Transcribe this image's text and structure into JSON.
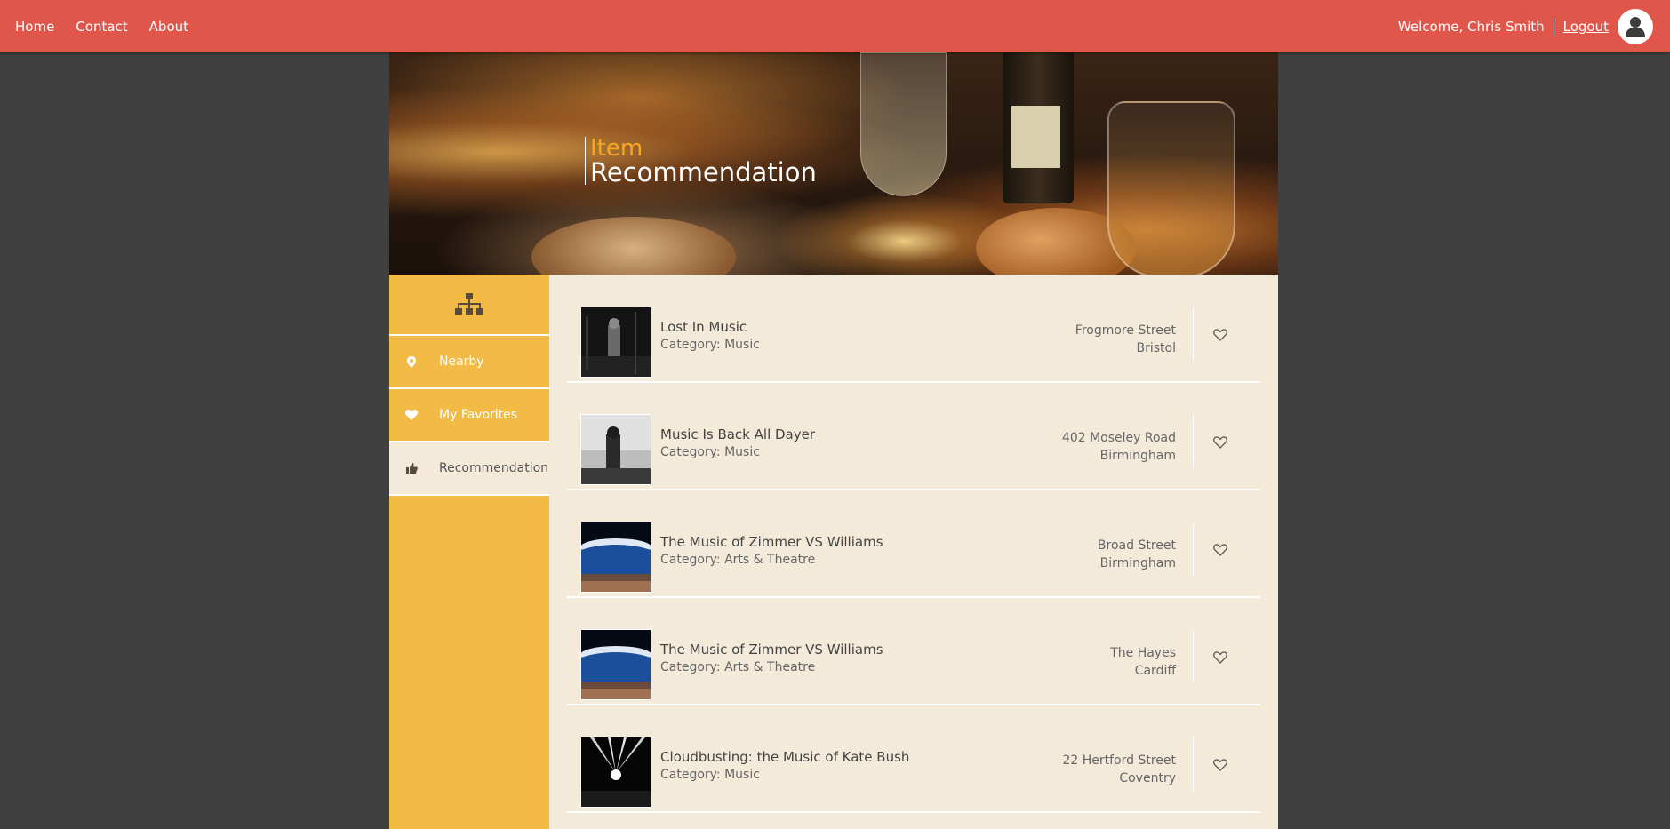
{
  "nav": {
    "home": "Home",
    "contact": "Contact",
    "about": "About"
  },
  "user": {
    "welcome": "Welcome, Chris Smith",
    "logout": "Logout",
    "avatar_icon": "user-icon"
  },
  "hero": {
    "title_line1": "Item",
    "title_line2": "Recommendation"
  },
  "sidebar": {
    "top_icon": "sitemap-icon",
    "items": [
      {
        "label": "Nearby",
        "icon": "map-pin-icon",
        "active": false
      },
      {
        "label": "My Favorites",
        "icon": "heart-icon",
        "active": false
      },
      {
        "label": "Recommendation",
        "icon": "thumbs-up-icon",
        "active": true
      }
    ]
  },
  "items": [
    {
      "name": "Lost In Music",
      "category": "Category: Music",
      "address1": "Frogmore Street",
      "address2": "Bristol"
    },
    {
      "name": "Music Is Back All Dayer",
      "category": "Category: Music",
      "address1": "402 Moseley Road",
      "address2": "Birmingham"
    },
    {
      "name": "The Music of Zimmer VS Williams",
      "category": "Category: Arts & Theatre",
      "address1": "Broad Street",
      "address2": "Birmingham"
    },
    {
      "name": "The Music of Zimmer VS Williams",
      "category": "Category: Arts & Theatre",
      "address1": "The Hayes",
      "address2": "Cardiff"
    },
    {
      "name": "Cloudbusting: the Music of Kate Bush",
      "category": "Category: Music",
      "address1": "22 Hertford Street",
      "address2": "Coventry"
    }
  ],
  "colors": {
    "topbar": "#e0564a",
    "sidebar": "#f2bb45",
    "main_bg": "#f3eada",
    "accent": "#f5a623"
  }
}
